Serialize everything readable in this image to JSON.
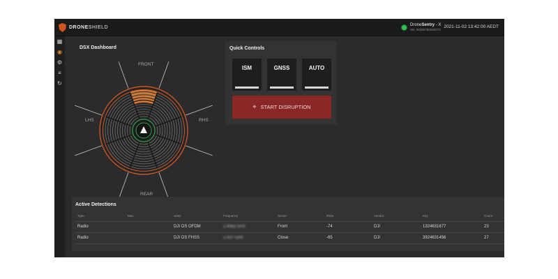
{
  "brand": {
    "name_part1": "DRONE",
    "name_part2": "SHIELD"
  },
  "device": {
    "name_part1": "Drone",
    "name_part2": "Sentry",
    "name_suffix": "- X",
    "serial": "SN: 00460780042073",
    "status_color": "#2fbf52"
  },
  "datetime": "2021-11-02 13:42:00 AEDT",
  "sidebar": {
    "items": [
      {
        "icon": "grid-icon",
        "glyph": "▦",
        "active": false
      },
      {
        "icon": "radar-icon",
        "glyph": "◉",
        "active": true
      },
      {
        "icon": "gear-icon",
        "glyph": "⚙",
        "active": false
      },
      {
        "icon": "filter-icon",
        "glyph": "≡",
        "active": false
      },
      {
        "icon": "refresh-icon",
        "glyph": "↻",
        "active": false
      }
    ]
  },
  "dashboard": {
    "title": "DSX Dashboard",
    "labels": {
      "front": "FRONT",
      "rear": "REAR",
      "lhs": "LHS",
      "rhs": "RHS"
    },
    "active_sector": "front",
    "accent_color": "#e07a2e",
    "ring_color": "#c8562a"
  },
  "quick_controls": {
    "title": "Quick Controls",
    "buttons": [
      {
        "label": "ISM"
      },
      {
        "label": "GNSS"
      },
      {
        "label": "AUTO"
      }
    ],
    "disruption_label": "START DISRUPTION",
    "disruption_color": "#8a2626"
  },
  "detections": {
    "title": "Active Detections",
    "columns": [
      "Type",
      "Mac",
      "SSID",
      "Frequency",
      "Sector",
      "RSSI",
      "Vendor",
      "Key",
      "Count"
    ],
    "rows": [
      {
        "type": "Radio",
        "mac": "",
        "ssid": "DJI OS OFDM",
        "frequency": "2.4062 GHz",
        "sector": "Front",
        "rssi": "-74",
        "vendor": "DJI",
        "key": "1324631677",
        "count": "23"
      },
      {
        "type": "Radio",
        "mac": "",
        "ssid": "DJI OS FHSS",
        "frequency": "2.437 GHz",
        "sector": "Close",
        "rssi": "-65",
        "vendor": "DJI",
        "key": "3924631456",
        "count": "27"
      }
    ]
  }
}
